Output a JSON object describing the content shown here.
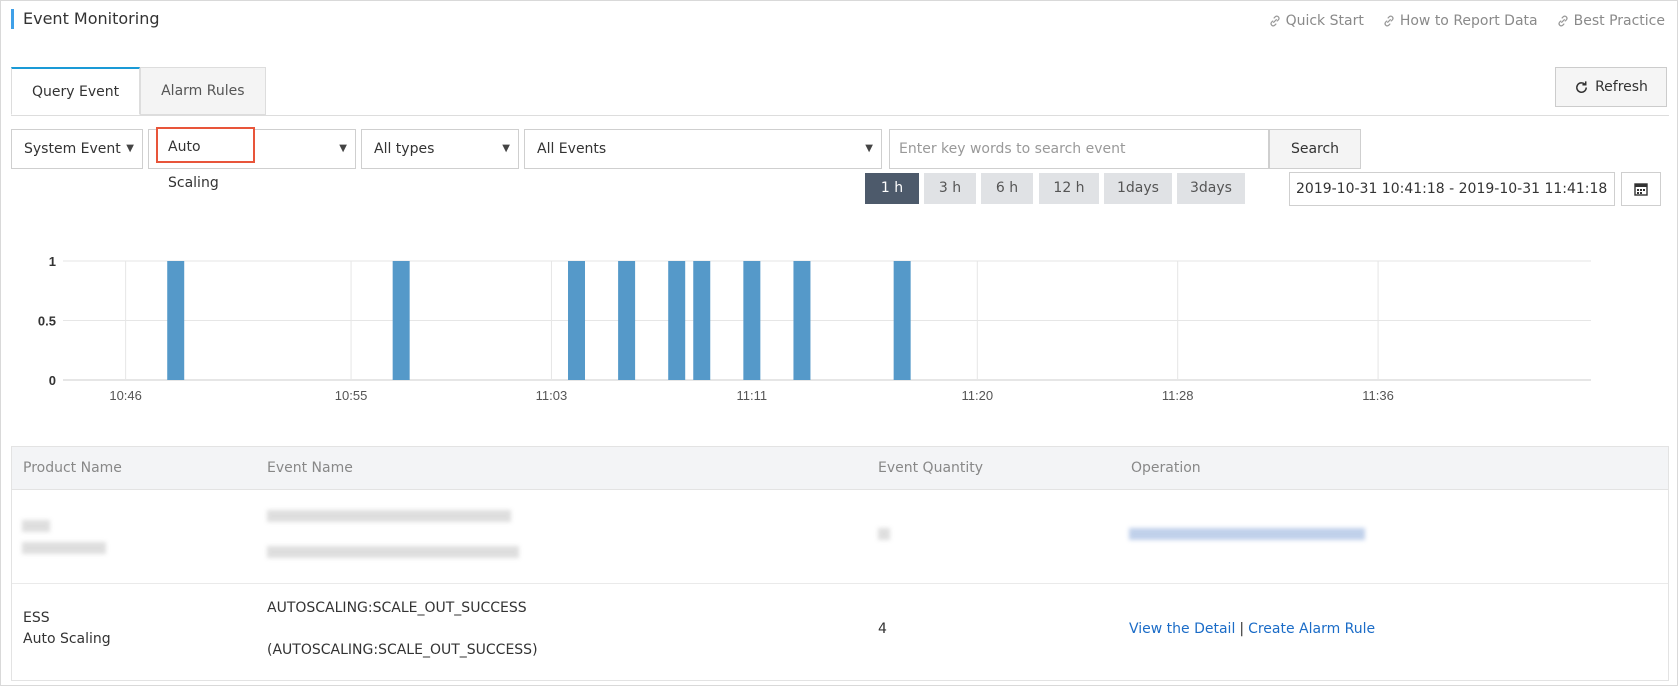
{
  "header": {
    "title": "Event Monitoring",
    "links": [
      {
        "label": "Quick Start",
        "icon": "link-icon"
      },
      {
        "label": "How to Report Data",
        "icon": "link-icon"
      },
      {
        "label": "Best Practice",
        "icon": "link-icon"
      }
    ]
  },
  "tabs": [
    {
      "label": "Query Event",
      "active": true
    },
    {
      "label": "Alarm Rules",
      "active": false
    }
  ],
  "refresh_label": "Refresh",
  "filters": {
    "event_source": "System Event",
    "product": "Auto Scaling",
    "type": "All types",
    "event": "All Events",
    "search_placeholder": "Enter key words to search event",
    "search_label": "Search"
  },
  "time_ranges": [
    {
      "label": "1 h",
      "active": true
    },
    {
      "label": "3 h",
      "active": false
    },
    {
      "label": "6 h",
      "active": false
    },
    {
      "label": "12 h",
      "active": false
    },
    {
      "label": "1days",
      "active": false
    },
    {
      "label": "3days",
      "active": false
    }
  ],
  "date_range": "2019-10-31 10:41:18 - 2019-10-31 11:41:18",
  "colors": {
    "bar": "#5599c9",
    "active_range": "#4d5a6b",
    "highlight": "#e8553a",
    "link": "#1b6cc7"
  },
  "chart_data": {
    "type": "bar",
    "x": [
      "10:48",
      "10:57",
      "11:04",
      "11:06",
      "11:08",
      "11:09",
      "11:11",
      "11:13",
      "11:17"
    ],
    "values": [
      1,
      1,
      1,
      1,
      1,
      1,
      1,
      1,
      1
    ],
    "xticks": [
      "10:46",
      "10:55",
      "11:03",
      "11:11",
      "11:20",
      "11:28",
      "11:36"
    ],
    "yticks": [
      "1",
      "0.5",
      "0"
    ],
    "ylim": [
      0,
      1
    ],
    "grid": true
  },
  "table": {
    "columns": [
      "Product Name",
      "Event Name",
      "Event Quantity",
      "Operation"
    ],
    "rows": [
      {
        "product_line1": "ESS",
        "product_line2": "Auto Scaling",
        "event_line1": "AUTOSCALING:SCALE_OUT_SUCCESS",
        "event_line2": "(AUTOSCALING:SCALE_OUT_SUCCESS)",
        "quantity": "4",
        "op_detail": "View the Detail",
        "op_separator": "|",
        "op_create": "Create Alarm Rule"
      }
    ]
  }
}
